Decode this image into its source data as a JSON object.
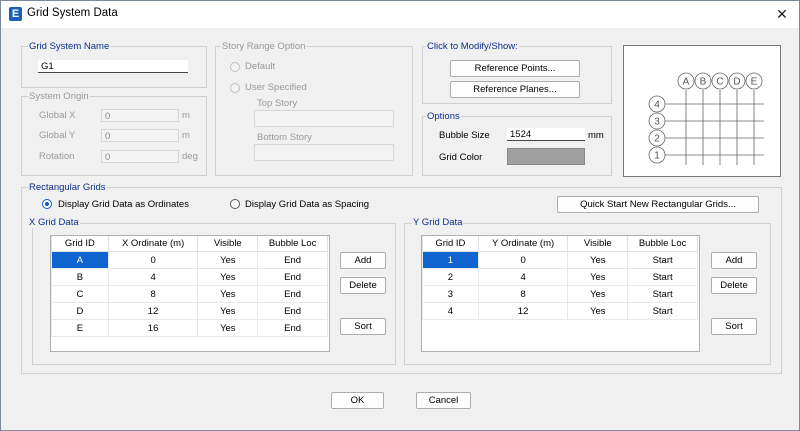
{
  "window": {
    "title": "Grid System Data",
    "icon_letter": "E",
    "close_glyph": "✕"
  },
  "grid_system_name": {
    "label": "Grid System Name",
    "value": "G1"
  },
  "story_range": {
    "label": "Story Range Option",
    "default_label": "Default",
    "user_specified_label": "User Specified",
    "top_story_label": "Top Story",
    "bottom_story_label": "Bottom Story"
  },
  "click_to_modify": {
    "label": "Click to Modify/Show:",
    "reference_points_label": "Reference Points...",
    "reference_planes_label": "Reference Planes..."
  },
  "system_origin": {
    "label": "System Origin",
    "global_x_label": "Global  X",
    "global_x_value": "0",
    "global_x_unit": "m",
    "global_y_label": "Global  Y",
    "global_y_value": "0",
    "global_y_unit": "m",
    "rotation_label": "Rotation",
    "rotation_value": "0",
    "rotation_unit": "deg"
  },
  "options": {
    "label": "Options",
    "bubble_size_label": "Bubble Size",
    "bubble_size_value": "1524",
    "bubble_size_unit": "mm",
    "grid_color_label": "Grid Color",
    "grid_color_value": "#a0a0a0"
  },
  "preview": {
    "x_bubbles": [
      "A",
      "B",
      "C",
      "D",
      "E"
    ],
    "y_bubbles": [
      "4",
      "3",
      "2",
      "1"
    ]
  },
  "rectangular_grids": {
    "label": "Rectangular Grids",
    "ordinates_label": "Display Grid Data as Ordinates",
    "spacing_label": "Display Grid Data as Spacing",
    "quick_start_label": "Quick Start New Rectangular Grids..."
  },
  "x_grid": {
    "label": "X Grid Data",
    "headers": [
      "Grid ID",
      "X Ordinate  (m)",
      "Visible",
      "Bubble Loc"
    ],
    "rows": [
      [
        "A",
        "0",
        "Yes",
        "End"
      ],
      [
        "B",
        "4",
        "Yes",
        "End"
      ],
      [
        "C",
        "8",
        "Yes",
        "End"
      ],
      [
        "D",
        "12",
        "Yes",
        "End"
      ],
      [
        "E",
        "16",
        "Yes",
        "End"
      ]
    ],
    "add_label": "Add",
    "delete_label": "Delete",
    "sort_label": "Sort"
  },
  "y_grid": {
    "label": "Y Grid Data",
    "headers": [
      "Grid ID",
      "Y Ordinate  (m)",
      "Visible",
      "Bubble Loc"
    ],
    "rows": [
      [
        "1",
        "0",
        "Yes",
        "Start"
      ],
      [
        "2",
        "4",
        "Yes",
        "Start"
      ],
      [
        "3",
        "8",
        "Yes",
        "Start"
      ],
      [
        "4",
        "12",
        "Yes",
        "Start"
      ]
    ],
    "add_label": "Add",
    "delete_label": "Delete",
    "sort_label": "Sort"
  },
  "footer": {
    "ok_label": "OK",
    "cancel_label": "Cancel"
  }
}
